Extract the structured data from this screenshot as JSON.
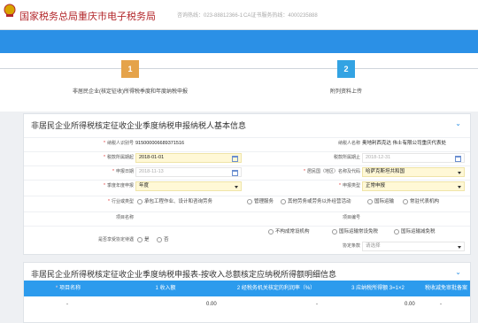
{
  "header": {
    "site_title": "国家税务总局重庆市电子税务局",
    "hotline": "咨询热线：023-88812366-1",
    "ca_hotline": "CA证书服务热线：4000235888"
  },
  "steps": [
    {
      "number": "1",
      "label": "非居民企业(核定征收)所得税季度和年度纳税申报",
      "color": "#e5a34a"
    },
    {
      "number": "2",
      "label": "附列资料上传",
      "color": "#33a3e3"
    }
  ],
  "basic_info": {
    "title": "非居民企业所得税核定征收企业季度纳税申报纳税人基本信息",
    "taxpayer_id_label": "纳税人识别号",
    "taxpayer_id": "915000006689371516",
    "taxpayer_name_label": "纳税人名称",
    "taxpayer_name": "奥地利西克达 伟士有限公司重庆代表处",
    "period_start_label": "税款所属期起",
    "period_start": "2018-01-01",
    "period_end_label": "税款所属期止",
    "period_end": "2018-12-31",
    "apply_date_label": "申报日期",
    "apply_date": "2018-11-13",
    "country_label": "居民国（地区）名称及代码",
    "country": "哈萨克斯坦共和国",
    "declare_type_label": "季度年度申报",
    "declare_type": "年度",
    "report_type_label": "申报类型",
    "report_type": "正常申报",
    "industry_label": "行业或类型",
    "industry_options": [
      "承包工程作业、设计和咨询劳务",
      "管理服务",
      "其他劳务或劳务以外经营活动",
      "国际运输",
      "常驻代表机构"
    ],
    "project_name_label": "项目名称",
    "project_no_label": "项目编号",
    "treaty_label": "是否享受协定待遇",
    "yes": "是",
    "no": "否",
    "treaty_options": [
      "不构成常设机构",
      "国际运输常设免税",
      "国际运输减免税"
    ],
    "treaty_clause_label": "协定条款",
    "treaty_clause_placeholder": "请选择"
  },
  "detail": {
    "title": "非居民企业所得税核定征收企业季度纳税申报表-按收入总额核定应纳税所得额明细信息",
    "columns": [
      "项目名称",
      "1 收入额",
      "2 经税务机关核定的利润率（%）",
      "3 应纳税所得额 3=1×2",
      "税收减免审批备案"
    ],
    "row": [
      "-",
      "0.00",
      "-",
      "0.00",
      "-"
    ]
  },
  "colors": {
    "brand_red": "#b3292d",
    "primary_blue": "#2b90e6",
    "step_orange": "#e5a34a",
    "required": "#e03030"
  }
}
